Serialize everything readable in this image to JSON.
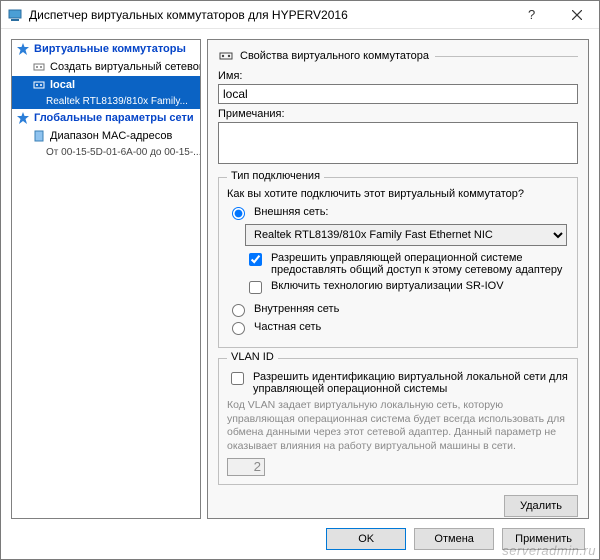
{
  "window": {
    "title": "Диспетчер виртуальных коммутаторов для HYPERV2016"
  },
  "tree": {
    "section_switches": "Виртуальные коммутаторы",
    "new_switch": "Создать виртуальный сетевой к...",
    "selected_switch": "local",
    "selected_nic": "Realtek RTL8139/810x Family...",
    "section_global": "Глобальные параметры сети",
    "mac_range": "Диапазон MAC-адресов",
    "mac_range_value": "От 00-15-5D-01-6A-00 до 00-15-..."
  },
  "panel": {
    "header": "Свойства виртуального коммутатора",
    "name_label": "Имя:",
    "name_value": "local",
    "notes_label": "Примечания:",
    "notes_value": "",
    "conn_group": "Тип подключения",
    "conn_question": "Как вы хотите подключить этот виртуальный коммутатор?",
    "external": "Внешняя сеть:",
    "nic_option": "Realtek RTL8139/810x Family Fast Ethernet NIC",
    "allow_mgmt": "Разрешить управляющей операционной системе предоставлять общий доступ к этому сетевому адаптеру",
    "sriov": "Включить технологию виртуализации SR-IOV",
    "internal": "Внутренняя сеть",
    "private": "Частная сеть",
    "vlan_group": "VLAN ID",
    "vlan_check": "Разрешить идентификацию виртуальной локальной сети для управляющей операционной системы",
    "vlan_desc": "Код VLAN задает виртуальную локальную сеть, которую управляющая операционная система будет всегда использовать для обмена данными через этот сетевой адаптер. Данный параметр не оказывает влияния на работу виртуальной машины в сети.",
    "vlan_value": "2",
    "delete": "Удалить"
  },
  "footer": {
    "ok": "OK",
    "cancel": "Отмена",
    "apply": "Применить"
  },
  "watermark": "serveradmin.ru"
}
